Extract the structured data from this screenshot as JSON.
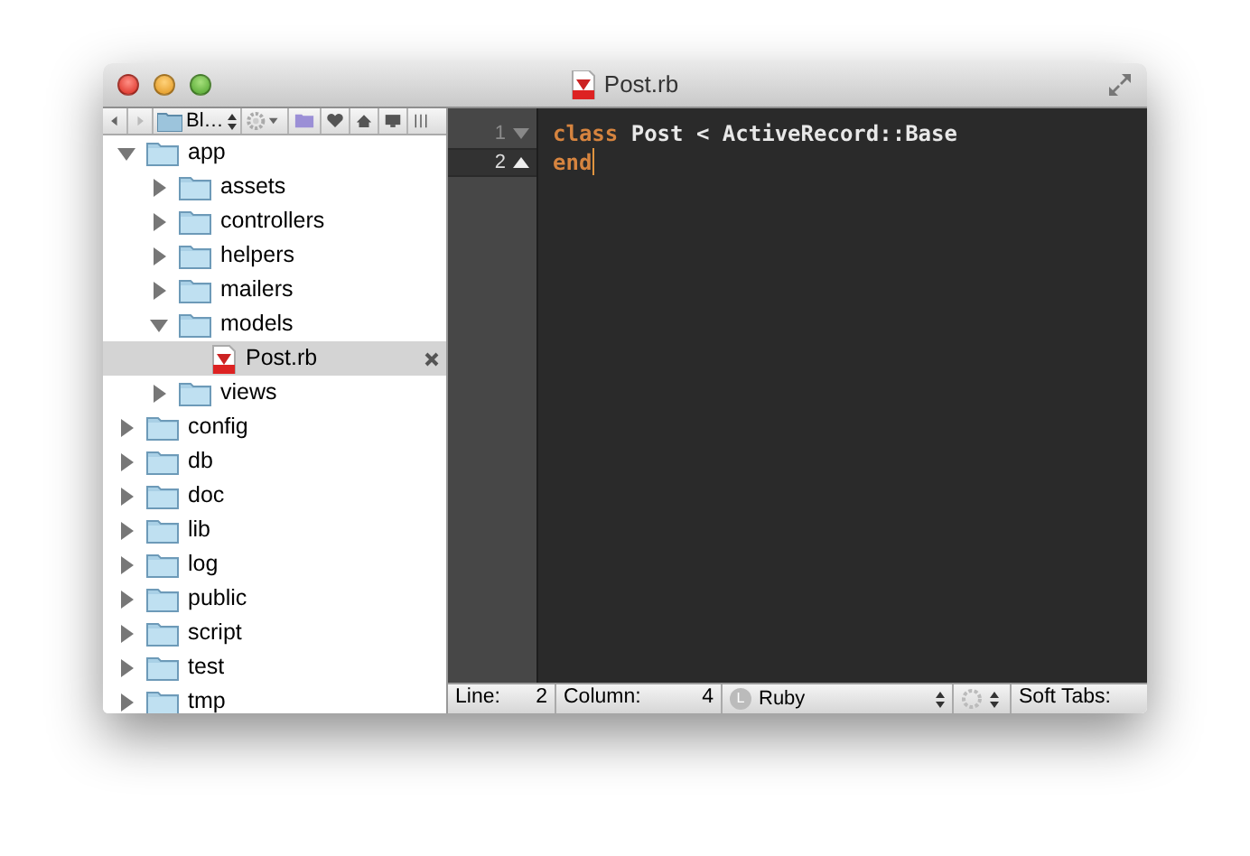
{
  "window": {
    "title": "Post.rb"
  },
  "toolbar": {
    "folder_popup": "Bl…"
  },
  "tree": [
    {
      "name": "app",
      "kind": "folder",
      "expanded": true,
      "selected": false,
      "children": [
        {
          "name": "assets",
          "kind": "folder",
          "expanded": false,
          "selected": false
        },
        {
          "name": "controllers",
          "kind": "folder",
          "expanded": false,
          "selected": false
        },
        {
          "name": "helpers",
          "kind": "folder",
          "expanded": false,
          "selected": false
        },
        {
          "name": "mailers",
          "kind": "folder",
          "expanded": false,
          "selected": false
        },
        {
          "name": "models",
          "kind": "folder",
          "expanded": true,
          "selected": false,
          "children": [
            {
              "name": "Post.rb",
              "kind": "file",
              "selected": true
            }
          ]
        },
        {
          "name": "views",
          "kind": "folder",
          "expanded": false,
          "selected": false
        }
      ]
    },
    {
      "name": "config",
      "kind": "folder",
      "expanded": false,
      "selected": false
    },
    {
      "name": "db",
      "kind": "folder",
      "expanded": false,
      "selected": false
    },
    {
      "name": "doc",
      "kind": "folder",
      "expanded": false,
      "selected": false
    },
    {
      "name": "lib",
      "kind": "folder",
      "expanded": false,
      "selected": false
    },
    {
      "name": "log",
      "kind": "folder",
      "expanded": false,
      "selected": false
    },
    {
      "name": "public",
      "kind": "folder",
      "expanded": false,
      "selected": false
    },
    {
      "name": "script",
      "kind": "folder",
      "expanded": false,
      "selected": false
    },
    {
      "name": "test",
      "kind": "folder",
      "expanded": false,
      "selected": false
    },
    {
      "name": "tmp",
      "kind": "folder",
      "expanded": false,
      "selected": false
    }
  ],
  "editor": {
    "lines": [
      {
        "number": "1",
        "kind": "fold_start",
        "current": false,
        "tokens": [
          {
            "text": "class",
            "kind": "keyword"
          },
          {
            "text": " Post < ActiveRecord::Base",
            "kind": "plain"
          }
        ]
      },
      {
        "number": "2",
        "kind": "fold_end",
        "current": true,
        "tokens": [
          {
            "text": "end",
            "kind": "keyword"
          }
        ]
      }
    ]
  },
  "status_bar": {
    "line_label": "Line:",
    "line": "2",
    "column_label": "Column:",
    "column": "4",
    "language_badge": "L",
    "language": "Ruby",
    "tabs": "Soft Tabs:"
  }
}
